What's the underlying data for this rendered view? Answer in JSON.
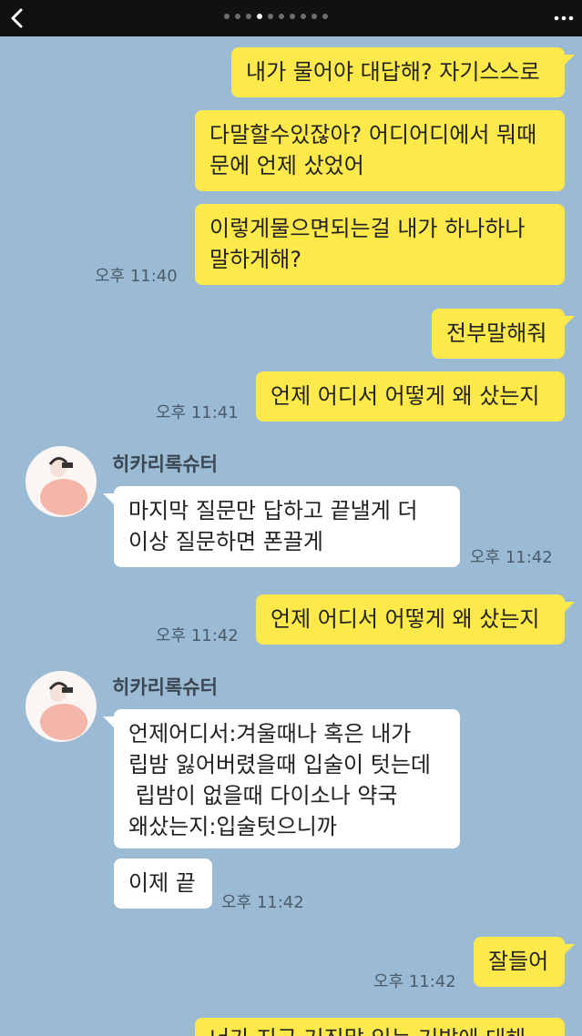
{
  "header": {
    "back_icon": "chevron-left-icon",
    "more_icon": "more-dots-icon",
    "page_dots_count": 10,
    "page_dots_active_index": 3
  },
  "colors": {
    "background": "#9bbbd4",
    "my_bubble": "#fee94a",
    "other_bubble": "#ffffff",
    "topbar": "#111111"
  },
  "sender": {
    "name": "히카리록슈터"
  },
  "messages": [
    {
      "text": "내가 물어야 대답해? 자기스스로"
    },
    {
      "text": "다말할수있잖아? 어디어디에서 뭐때\n문에 언제 샀었어"
    },
    {
      "text": "이렇게물으면되는걸 내가 하나하나\n말하게해?",
      "time": "오후 11:40"
    },
    {
      "text": "전부말해줘"
    },
    {
      "text": "언제 어디서 어떻게 왜 샀는지",
      "time": "오후 11:41"
    },
    {
      "text": "마지막 질문만 답하고 끝낼게 더\n이상 질문하면 폰끌게",
      "time": "오후 11:42"
    },
    {
      "text": "언제 어디서 어떻게 왜 샀는지",
      "time": "오후 11:42"
    },
    {
      "text": "언제어디서:겨울때나 혹은 내가\n립밤 잃어버렸을때 입술이 텃는데\n 립밤이 없을때 다이소나 약국\n왜샀는지:입술텃으니까"
    },
    {
      "text": "이제 끝",
      "time": "오후 11:42"
    },
    {
      "text": "잘들어",
      "time": "오후 11:42"
    },
    {
      "text": "너가 지금 거짓말 있는 거발에 대해"
    }
  ]
}
